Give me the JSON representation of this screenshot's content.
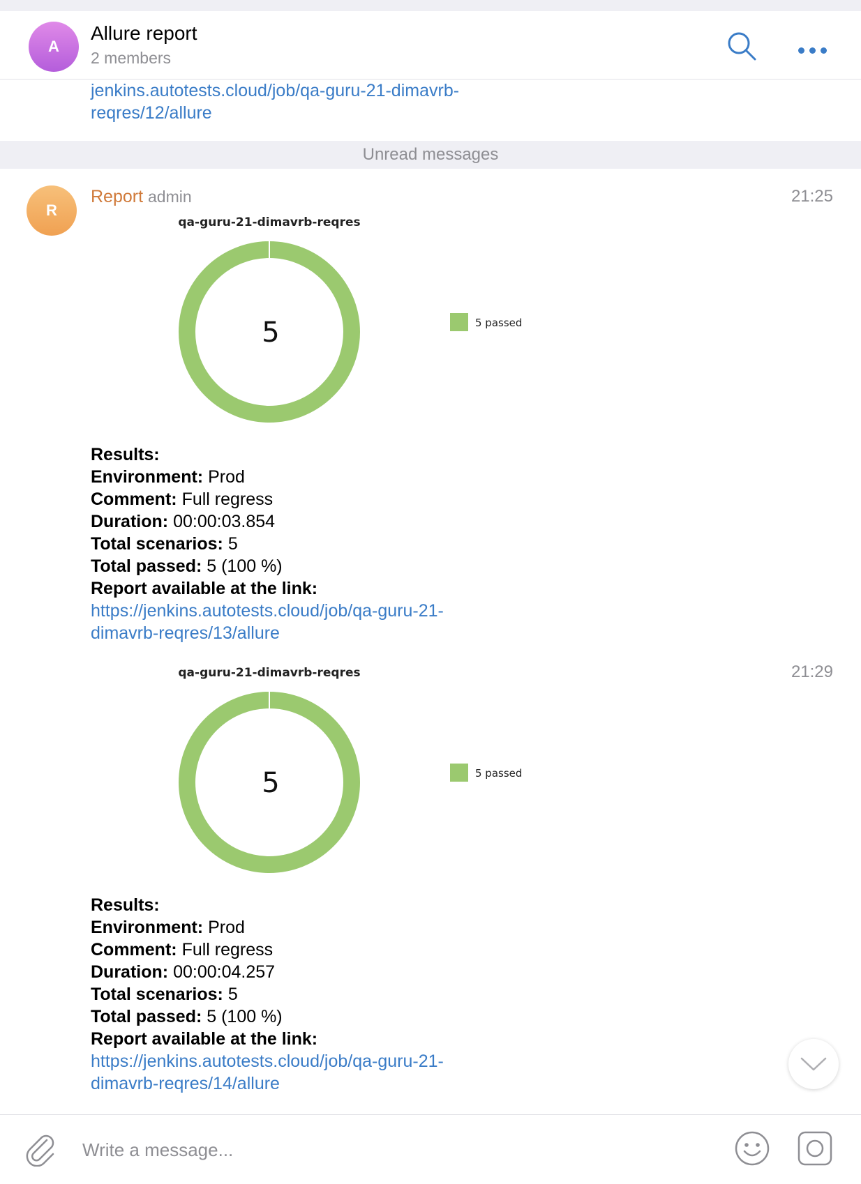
{
  "header": {
    "avatar_letter": "A",
    "title": "Allure report",
    "members": "2 members",
    "search_icon": "search-icon",
    "more_icon": "more-icon"
  },
  "previous_message": {
    "link_text": "jenkins.autotests.cloud/job/qa-guru-21-dimavrb-reqres/12/allure"
  },
  "unread_label": "Unread messages",
  "sender": {
    "avatar_letter": "R",
    "name": "Report",
    "role": "admin"
  },
  "messages": [
    {
      "time": "21:25",
      "results": {
        "heading": "Results:",
        "environment_label": "Environment:",
        "environment": "Prod",
        "comment_label": "Comment:",
        "comment": "Full regress",
        "duration_label": "Duration:",
        "duration": "00:00:03.854",
        "total_scenarios_label": "Total scenarios:",
        "total_scenarios": "5",
        "total_passed_label": "Total passed:",
        "total_passed": "5 (100 %)",
        "report_label": "Report available at the link:",
        "report_link": "https://jenkins.autotests.cloud/job/qa-guru-21-dimavrb-reqres/13/allure"
      }
    },
    {
      "time": "21:29",
      "results": {
        "heading": "Results:",
        "environment_label": "Environment:",
        "environment": "Prod",
        "comment_label": "Comment:",
        "comment": "Full regress",
        "duration_label": "Duration:",
        "duration": "00:00:04.257",
        "total_scenarios_label": "Total scenarios:",
        "total_scenarios": "5",
        "total_passed_label": "Total passed:",
        "total_passed": "5 (100 %)",
        "report_label": "Report available at the link:",
        "report_link": "https://jenkins.autotests.cloud/job/qa-guru-21-dimavrb-reqres/14/allure"
      }
    }
  ],
  "chart_data": [
    {
      "type": "pie",
      "title": "qa-guru-21-dimavrb-reqres",
      "center_label": "5",
      "categories": [
        "passed"
      ],
      "values": [
        5
      ],
      "legend": [
        "5 passed"
      ],
      "legend_placement": "right",
      "colors": [
        "#9bc96f"
      ]
    },
    {
      "type": "pie",
      "title": "qa-guru-21-dimavrb-reqres",
      "center_label": "5",
      "categories": [
        "passed"
      ],
      "values": [
        5
      ],
      "legend": [
        "5 passed"
      ],
      "legend_placement": "right",
      "colors": [
        "#9bc96f"
      ]
    }
  ],
  "composer": {
    "placeholder": "Write a message...",
    "attach_icon": "paperclip-icon",
    "emoji_icon": "emoji-icon",
    "camera_icon": "camera-icon"
  },
  "scroll_down_icon": "chevron-down-icon",
  "colors": {
    "link": "#3a7cc7",
    "sender": "#d07a3a",
    "passed": "#9bc96f",
    "muted": "#8e8e93"
  }
}
